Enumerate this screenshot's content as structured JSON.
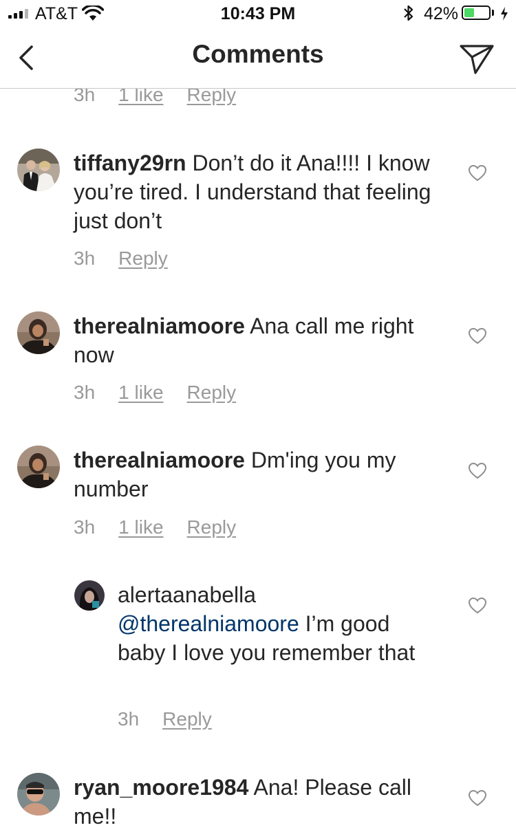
{
  "status_bar": {
    "carrier": "AT&T",
    "time": "10:43 PM",
    "battery_percent": "42%",
    "battery_level": 0.42,
    "battery_color": "#4cd964"
  },
  "header": {
    "title": "Comments",
    "back_icon": "chevron-left-icon",
    "share_icon": "paper-plane-icon"
  },
  "comments": [
    {
      "meta_time": "3h",
      "likes": "1 like",
      "reply": "Reply"
    },
    {
      "username": "tiffany29rn",
      "text": "Don’t do it Ana!!!! I know you’re tired. I understand that feeling just don’t",
      "time": "3h",
      "likes": "",
      "reply": "Reply"
    },
    {
      "username": "therealniamoore",
      "text": "Ana call me right now",
      "time": "3h",
      "likes": "1 like",
      "reply": "Reply"
    },
    {
      "username": "therealniamoore",
      "text": "Dm'ing you my number",
      "time": "3h",
      "likes": "1 like",
      "reply": "Reply"
    },
    {
      "username": "alertaanabella",
      "mention": "@therealniamoore",
      "text": "I’m good baby I love you remember that",
      "time": "3h",
      "likes": "",
      "reply": "Reply",
      "is_reply": true
    },
    {
      "username": "ryan_moore1984",
      "text": "Ana!  Please call me!!"
    }
  ]
}
